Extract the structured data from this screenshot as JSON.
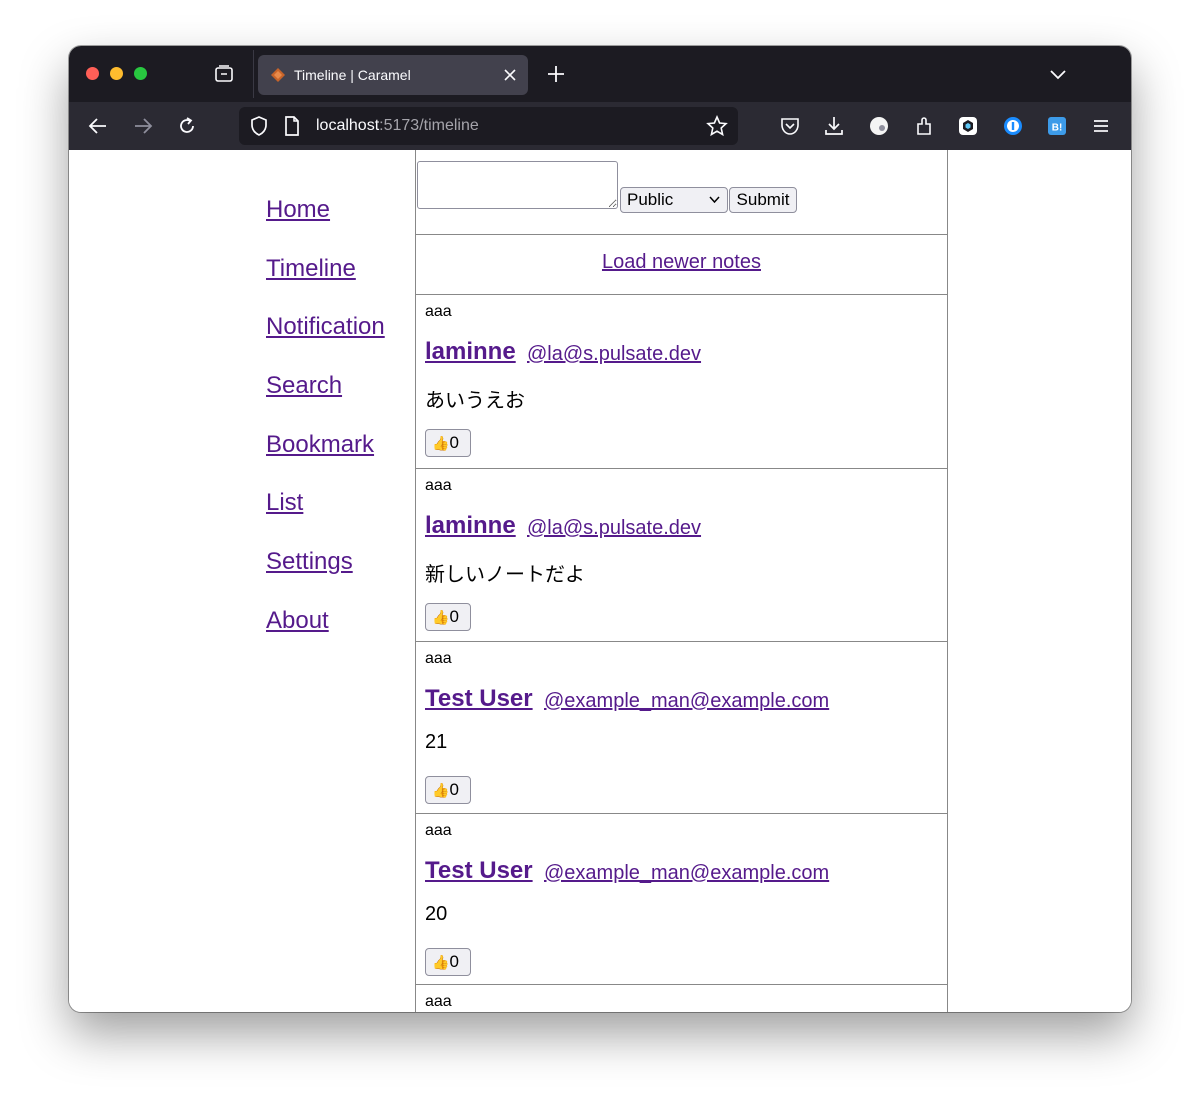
{
  "browser": {
    "tab_title": "Timeline | Caramel",
    "url_host": "localhost",
    "url_rest": ":5173/timeline"
  },
  "sidebar": {
    "items": [
      {
        "label": "Home"
      },
      {
        "label": "Timeline"
      },
      {
        "label": "Notification"
      },
      {
        "label": "Search"
      },
      {
        "label": "Bookmark"
      },
      {
        "label": "List"
      },
      {
        "label": "Settings"
      },
      {
        "label": "About"
      }
    ]
  },
  "composer": {
    "text_value": "",
    "visibility_selected": "Public",
    "submit_label": "Submit"
  },
  "load_newer_label": "Load newer notes",
  "notes": [
    {
      "small": "aaa",
      "name": "laminne",
      "handle": "@la@s.pulsate.dev",
      "body": "あいうえお",
      "reaction_icon": "👍",
      "reaction_count": "0"
    },
    {
      "small": "aaa",
      "name": "laminne",
      "handle": "@la@s.pulsate.dev",
      "body": "新しいノートだよ",
      "reaction_icon": "👍",
      "reaction_count": "0"
    },
    {
      "small": "aaa",
      "name": "Test User",
      "handle": "@example_man@example.com",
      "body": "21",
      "reaction_icon": "👍",
      "reaction_count": "0"
    },
    {
      "small": "aaa",
      "name": "Test User",
      "handle": "@example_man@example.com",
      "body": "20",
      "reaction_icon": "👍",
      "reaction_count": "0"
    },
    {
      "small": "aaa"
    }
  ],
  "colors": {
    "link": "#551a8b",
    "tabbar": "#1c1b22",
    "navbar": "#2b2a33",
    "active_tab": "#42414d",
    "traffic_red": "#ff5f57",
    "traffic_yellow": "#febc2e",
    "traffic_green": "#28c840"
  }
}
